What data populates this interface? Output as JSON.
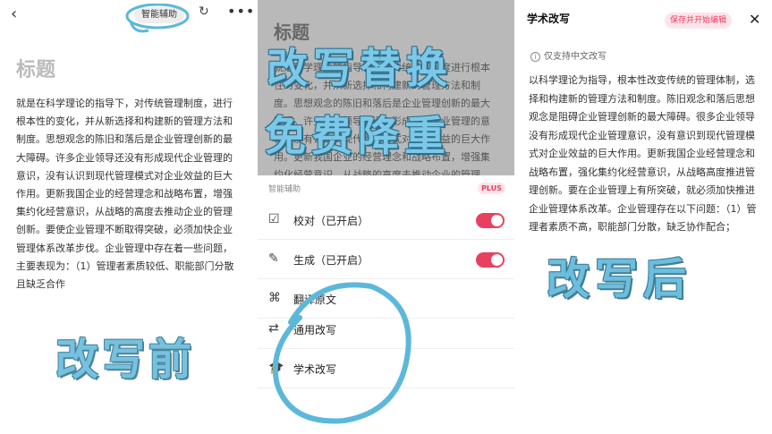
{
  "left": {
    "back_icon": "chevron-left-icon",
    "smart_assist_label": "智能辅助",
    "refresh_icon": "refresh-icon",
    "more_icon": "more-icon",
    "title": "标题",
    "body": "就是在科学理论的指导下，对传统管理制度，进行根本性的变化，并从新选择和构建新的管理方法和制度。思想观念的陈旧和落后是企业管理创新的最大障碍。许多企业领导还没有形成现代企业管理的意识，没有认识到现代管理模式对企业效益的巨大作用。更新我国企业的经营理念和战略布置，增强集约化经营意识，从战略的高度去推动企业的管理创新。要使企业管理不断取得突破，必须加快企业管理体系改革步伐。企业管理中存在着一些问题，主要表现为：（1）管理者素质较低、职能部门分散且缺乏合作",
    "annotation": "改写前"
  },
  "middle": {
    "title": "标题",
    "body": "就是科学理论的指导下，对传统管理制度进行根本性的变化，并从新选择和构建新的管理方法和制度。思想观念的陈旧和落后是企业管理创新的最大障碍。许多企业领导还没有形成现代企业管理的意识，没有认识到现代管理模式对企业效益的巨大作用。更新我国企业的经营理念和战略布置，增强集约化经营意识，从战略的高度去推动企业的管理",
    "annotation_line1": "改写替换",
    "annotation_line2": "免费降重",
    "sheet_header": "智能辅助",
    "plus_badge": "PLUS",
    "menu": [
      {
        "label": "校对（已开启）",
        "icon": "proofread-icon",
        "toggle": true
      },
      {
        "label": "生成（已开启）",
        "icon": "generate-icon",
        "toggle": true
      },
      {
        "label": "翻译原文",
        "icon": "translate-icon",
        "toggle": false
      },
      {
        "label": "通用改写",
        "icon": "rewrite-icon",
        "toggle": false
      },
      {
        "label": "学术改写",
        "icon": "academic-cap-icon",
        "toggle": false
      }
    ]
  },
  "right": {
    "title": "学术改写",
    "save_label": "保存并开始编辑",
    "close_icon": "close-icon",
    "info_note": "仅支持中文改写",
    "body": "以科学理论为指导，根本性改变传统的管理体制，选择和构建新的管理方法和制度。陈旧观念和落后思想观念是阻碍企业管理创新的最大障碍。很多企业领导没有形成现代企业管理意识，没有意识到现代管理模式对企业效益的巨大作用。更新我国企业经营理念和战略布置，强化集约化经营意识，从战略高度推进管理创新。要在企业管理上有所突破，就必须加快推进企业管理体系改革。企业管理存在以下问题：（1）管理者素质不高，职能部门分散，缺乏协作配合；",
    "annotation": "改写后"
  },
  "colors": {
    "accent": "#e8415f",
    "annotation": "#5cb8db"
  }
}
